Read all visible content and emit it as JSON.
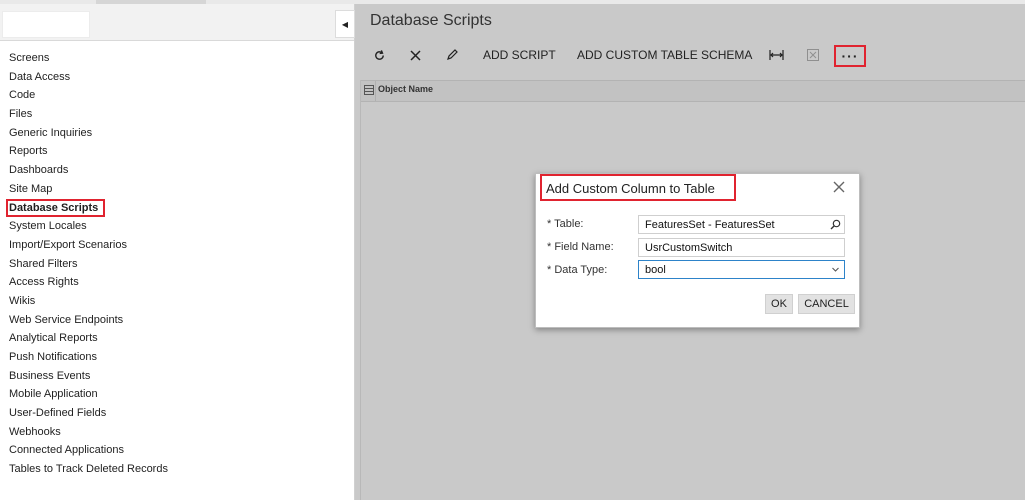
{
  "sidebar": {
    "items": [
      {
        "label": "Screens"
      },
      {
        "label": "Data Access"
      },
      {
        "label": "Code"
      },
      {
        "label": "Files"
      },
      {
        "label": "Generic Inquiries"
      },
      {
        "label": "Reports"
      },
      {
        "label": "Dashboards"
      },
      {
        "label": "Site Map"
      },
      {
        "label": "Database Scripts",
        "selected": true
      },
      {
        "label": "System Locales"
      },
      {
        "label": "Import/Export Scenarios"
      },
      {
        "label": "Shared Filters"
      },
      {
        "label": "Access Rights"
      },
      {
        "label": "Wikis"
      },
      {
        "label": "Web Service Endpoints"
      },
      {
        "label": "Analytical Reports"
      },
      {
        "label": "Push Notifications"
      },
      {
        "label": "Business Events"
      },
      {
        "label": "Mobile Application"
      },
      {
        "label": "User-Defined Fields"
      },
      {
        "label": "Webhooks"
      },
      {
        "label": "Connected Applications"
      },
      {
        "label": "Tables to Track Deleted Records"
      }
    ]
  },
  "main": {
    "title": "Database Scripts",
    "toolbar": {
      "add_script": "ADD SCRIPT",
      "add_custom_table_schema": "ADD CUSTOM TABLE SCHEMA",
      "more": "···"
    },
    "grid": {
      "columns": [
        "Object Name"
      ]
    }
  },
  "dialog": {
    "title": "Add Custom Column to Table",
    "fields": {
      "table": {
        "label": "* Table:",
        "value": "FeaturesSet - FeaturesSet"
      },
      "field_name": {
        "label": "* Field Name:",
        "value": "UsrCustomSwitch"
      },
      "data_type": {
        "label": "* Data Type:",
        "value": "bool"
      }
    },
    "buttons": {
      "ok": "OK",
      "cancel": "CANCEL"
    }
  },
  "colors": {
    "highlight_red": "#e0232f",
    "focus_blue": "#2d83c9",
    "backdrop_gray": "#c9c9c9"
  }
}
